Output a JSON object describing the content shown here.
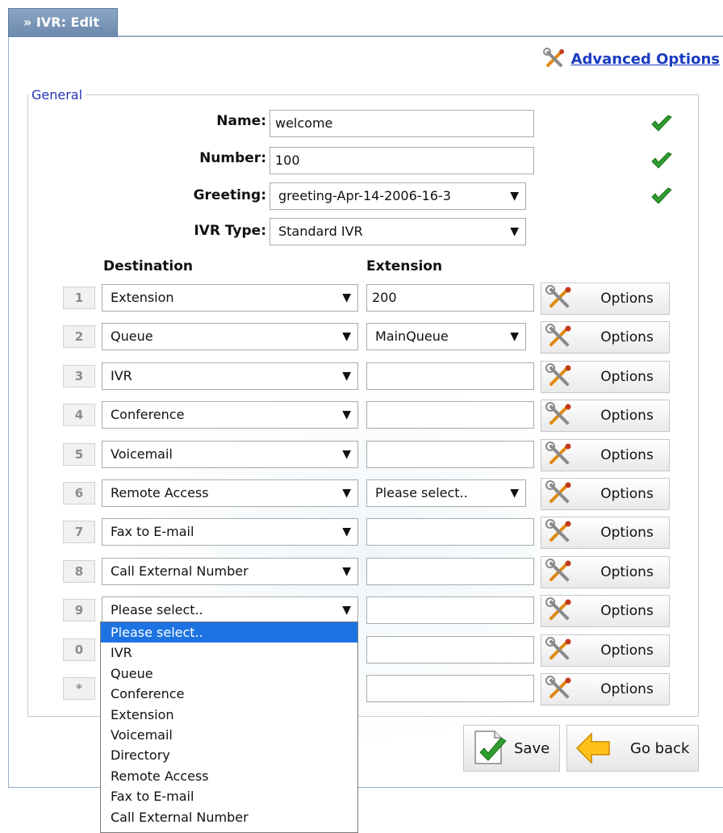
{
  "header": {
    "tab_title": "» IVR: Edit"
  },
  "advanced": {
    "label": "Advanced Options"
  },
  "general": {
    "legend": "General",
    "fields": {
      "name_label": "Name:",
      "name_value": "welcome",
      "number_label": "Number:",
      "number_value": "100",
      "greeting_label": "Greeting:",
      "greeting_value": "greeting-Apr-14-2006-16-3",
      "ivr_type_label": "IVR Type:",
      "ivr_type_value": "Standard IVR"
    },
    "columns": {
      "destination": "Destination",
      "extension": "Extension"
    },
    "options_label": "Options",
    "rows": [
      {
        "key": "1",
        "destination": "Extension",
        "extension": "200",
        "ext_kind": "input"
      },
      {
        "key": "2",
        "destination": "Queue",
        "extension": "MainQueue",
        "ext_kind": "select"
      },
      {
        "key": "3",
        "destination": "IVR",
        "extension": "",
        "ext_kind": "input"
      },
      {
        "key": "4",
        "destination": "Conference",
        "extension": "",
        "ext_kind": "input"
      },
      {
        "key": "5",
        "destination": "Voicemail",
        "extension": "",
        "ext_kind": "input"
      },
      {
        "key": "6",
        "destination": "Remote Access",
        "extension": "Please select..",
        "ext_kind": "select"
      },
      {
        "key": "7",
        "destination": "Fax to E-mail",
        "extension": "",
        "ext_kind": "input"
      },
      {
        "key": "8",
        "destination": "Call External Number",
        "extension": "",
        "ext_kind": "input"
      },
      {
        "key": "9",
        "destination": "Please select..",
        "extension": "",
        "ext_kind": "input"
      },
      {
        "key": "0",
        "destination": "",
        "extension": "",
        "ext_kind": "input"
      },
      {
        "key": "*",
        "destination": "",
        "extension": "",
        "ext_kind": "input"
      }
    ],
    "dropdown_options": [
      "Please select..",
      "IVR",
      "Queue",
      "Conference",
      "Extension",
      "Voicemail",
      "Directory",
      "Remote Access",
      "Fax to E-mail",
      "Call External Number"
    ]
  },
  "actions": {
    "save": "Save",
    "go_back": "Go back"
  },
  "colors": {
    "tab": "#7893b6",
    "link": "#1a3bbf",
    "highlight": "#1e73e2",
    "legend": "#2133b5"
  },
  "icons": [
    "tools-icon",
    "check-icon",
    "save-icon",
    "back-arrow-icon"
  ]
}
